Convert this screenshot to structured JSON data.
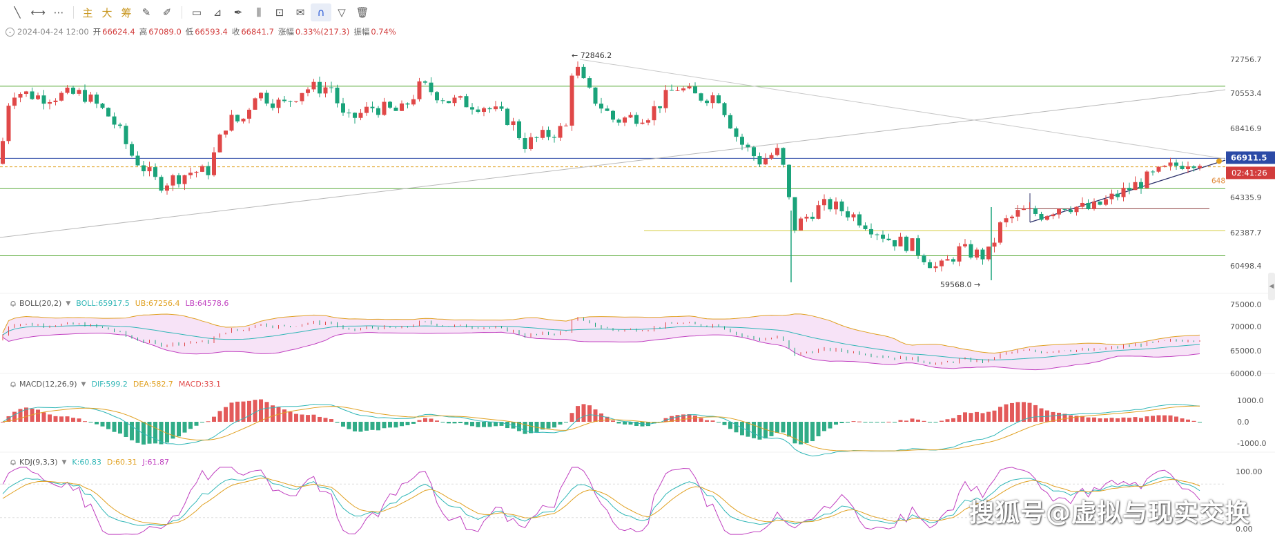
{
  "toolbar": {
    "items": [
      {
        "name": "trend-line-tool-icon",
        "glyph": "╲"
      },
      {
        "name": "horizontal-line-tool-icon",
        "glyph": "⟷"
      },
      {
        "name": "more-tools-icon",
        "glyph": "⋯"
      },
      {
        "sep": true
      },
      {
        "name": "main-chart-toggle",
        "text": "主",
        "cn": true
      },
      {
        "name": "large-order-toggle",
        "text": "大",
        "cn": true
      },
      {
        "name": "chip-distribution-toggle",
        "text": "筹",
        "cn": true
      },
      {
        "name": "draw-mode-icon",
        "glyph": "✎"
      },
      {
        "name": "brush-icon",
        "glyph": "✐"
      },
      {
        "sep": true
      },
      {
        "name": "rectangle-tool-icon",
        "glyph": "▭"
      },
      {
        "name": "ruler-tool-icon",
        "glyph": "⊿"
      },
      {
        "name": "pen-tool-icon",
        "glyph": "✒"
      },
      {
        "name": "candlestick-tool-icon",
        "glyph": "⫼"
      },
      {
        "name": "lock-icon",
        "glyph": "⊡"
      },
      {
        "name": "note-tool-icon",
        "glyph": "✉"
      },
      {
        "name": "magnet-icon",
        "glyph": "∩",
        "active": true
      },
      {
        "name": "filter-icon",
        "glyph": "▽"
      },
      {
        "name": "delete-icon",
        "glyph": "🗑"
      }
    ]
  },
  "ohlc": {
    "datetime": "2024-04-24 12:00",
    "open_label": "开",
    "open": "66624.4",
    "high_label": "高",
    "high": "67089.0",
    "low_label": "低",
    "low": "66593.4",
    "close_label": "收",
    "close": "66841.7",
    "change_label": "涨幅",
    "change": "0.33%(217.3)",
    "amp_label": "振幅",
    "amp": "0.74%"
  },
  "price_axis": {
    "ticks": [
      "72756.7",
      "70553.4",
      "68416.9",
      "64335.9",
      "62387.7",
      "60498.4"
    ],
    "current_price": "66911.5",
    "countdown": "02:41:26",
    "small_label": "648"
  },
  "annotations": {
    "high": "72846.2",
    "low": "59568.0"
  },
  "boll": {
    "name": "BOLL(20,2)",
    "items": [
      {
        "text": "BOLL:65917.5",
        "color": "#2fb6b6"
      },
      {
        "text": "UB:67256.4",
        "color": "#e0a020"
      },
      {
        "text": "LB:64578.6",
        "color": "#c040c0"
      }
    ],
    "ticks": [
      "75000.0",
      "70000.0",
      "65000.0",
      "60000.0"
    ]
  },
  "macd": {
    "name": "MACD(12,26,9)",
    "items": [
      {
        "text": "DIF:599.2",
        "color": "#2fb6b6"
      },
      {
        "text": "DEA:582.7",
        "color": "#e0a020"
      },
      {
        "text": "MACD:33.1",
        "color": "#e04848"
      }
    ],
    "ticks": [
      "1000.0",
      "0.0",
      "-1000.0"
    ]
  },
  "kdj": {
    "name": "KDJ(9,3,3)",
    "items": [
      {
        "text": "K:60.83",
        "color": "#2fb6b6"
      },
      {
        "text": "D:60.31",
        "color": "#e0a020"
      },
      {
        "text": "J:61.87",
        "color": "#c040c0"
      }
    ],
    "ticks": [
      "100.00",
      "0.00"
    ]
  },
  "watermark": "搜狐号@虚拟与现实交换",
  "colors": {
    "up": "#e04848",
    "down": "#1aa37a",
    "line_green": "#5aaa3a",
    "current": "#2b4aa6",
    "countdown": "#d23c3c"
  },
  "chart_data": [
    {
      "type": "candlestick",
      "title": "",
      "ylim": [
        59568.0,
        72846.2
      ],
      "marked_high": 72846.2,
      "marked_low": 59568.0,
      "last_close": 66911.5
    },
    {
      "type": "line",
      "title": "BOLL(20,2)",
      "series": [
        {
          "name": "BOLL",
          "values": [
            65917.5
          ]
        },
        {
          "name": "UB",
          "values": [
            67256.4
          ]
        },
        {
          "name": "LB",
          "values": [
            64578.6
          ]
        }
      ]
    },
    {
      "type": "bar",
      "title": "MACD(12,26,9)",
      "series": [
        {
          "name": "DIF",
          "values": [
            599.2
          ]
        },
        {
          "name": "DEA",
          "values": [
            582.7
          ]
        },
        {
          "name": "MACD",
          "values": [
            33.1
          ]
        }
      ]
    },
    {
      "type": "line",
      "title": "KDJ(9,3,3)",
      "series": [
        {
          "name": "K",
          "values": [
            60.83
          ]
        },
        {
          "name": "D",
          "values": [
            60.31
          ]
        },
        {
          "name": "J",
          "values": [
            61.87
          ]
        }
      ]
    }
  ]
}
